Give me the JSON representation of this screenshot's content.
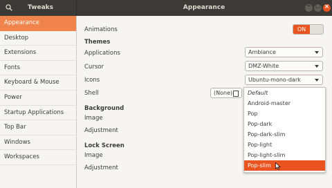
{
  "app_title": "Tweaks",
  "window_title": "Appearance",
  "window_buttons": {
    "minimize": "–",
    "maximize": "□",
    "close": "×"
  },
  "sidebar": {
    "items": [
      {
        "label": "Appearance",
        "active": true
      },
      {
        "label": "Desktop"
      },
      {
        "label": "Extensions"
      },
      {
        "label": "Fonts"
      },
      {
        "label": "Keyboard & Mouse"
      },
      {
        "label": "Power"
      },
      {
        "label": "Startup Applications"
      },
      {
        "label": "Top Bar"
      },
      {
        "label": "Windows"
      },
      {
        "label": "Workspaces"
      }
    ]
  },
  "main": {
    "animations": {
      "label": "Animations",
      "toggle": "ON"
    },
    "themes": {
      "heading": "Themes",
      "applications": {
        "label": "Applications",
        "value": "Ambiance"
      },
      "cursor": {
        "label": "Cursor",
        "value": "DMZ-White"
      },
      "icons": {
        "label": "Icons",
        "value": "Ubuntu-mono-dark"
      },
      "shell": {
        "label": "Shell",
        "value": "(None)"
      }
    },
    "background": {
      "heading": "Background",
      "image": "Image",
      "adjustment": "Adjustment"
    },
    "lock_screen": {
      "heading": "Lock Screen",
      "image": "Image",
      "adjustment": "Adjustment"
    }
  },
  "dropdown": {
    "options": [
      "Default",
      "Android-master",
      "Pop",
      "Pop-dark",
      "Pop-dark-slim",
      "Pop-light",
      "Pop-light-slim",
      "Pop-slim"
    ],
    "selected": "Pop-slim"
  },
  "colors": {
    "accent": "#e95420",
    "sidebar_active": "#f0844c",
    "header": "#3b3a36"
  }
}
